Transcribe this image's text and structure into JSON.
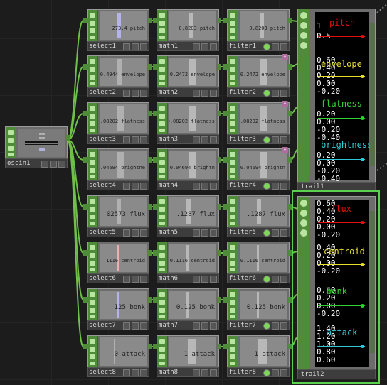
{
  "colors": {
    "wire": "#6fbf4a",
    "pitch": "#e01010",
    "envelope": "#e8e030",
    "flatness": "#30d030",
    "brightness": "#30c8d8",
    "flux": "#e01010",
    "centroid": "#e8e030",
    "bonk": "#30d030",
    "attack": "#30c8d8"
  },
  "oscin": {
    "name": "oscin1"
  },
  "rows": [
    {
      "select": {
        "name": "select1",
        "value": "273.4 pitch"
      },
      "math": {
        "name": "math1",
        "value": "0.8203 pitch"
      },
      "filter": {
        "name": "filter1",
        "value": "0.8203 pitch"
      }
    },
    {
      "select": {
        "name": "select2",
        "value": "0.4944 envelope"
      },
      "math": {
        "name": "math2",
        "value": "0.2472 envelope"
      },
      "filter": {
        "name": "filter2",
        "value": "0.2472 envelope"
      }
    },
    {
      "select": {
        "name": "select3",
        "value": "0.08202 flatness"
      },
      "math": {
        "name": "math3",
        "value": "0.08202 flatness"
      },
      "filter": {
        "name": "filter3",
        "value": "0.08202 flatness"
      }
    },
    {
      "select": {
        "name": "select4",
        "value": "0.04694 brightne"
      },
      "math": {
        "name": "math4",
        "value": "0.04694 brightn"
      },
      "filter": {
        "name": "filter4",
        "value": "0.04694 brightn"
      }
    },
    {
      "select": {
        "name": "select5",
        "value": "02573 flux"
      },
      "math": {
        "name": "math5",
        "value": ".1287 flux"
      },
      "filter": {
        "name": "filter5",
        "value": ".1287 flux"
      }
    },
    {
      "select": {
        "name": "select6",
        "value": "1116 centroid"
      },
      "math": {
        "name": "math6",
        "value": "0.1116 centroid"
      },
      "filter": {
        "name": "filter6",
        "value": "0.1116 centroid"
      }
    },
    {
      "select": {
        "name": "select7",
        "value": "125 bonk"
      },
      "math": {
        "name": "math7",
        "value": "0.125 bonk"
      },
      "filter": {
        "name": "filter7",
        "value": "0.125 bonk"
      }
    },
    {
      "select": {
        "name": "select8",
        "value": "0 attack"
      },
      "math": {
        "name": "math8",
        "value": "1 attack"
      },
      "filter": {
        "name": "filter8",
        "value": "1 attack"
      }
    }
  ],
  "trail1": {
    "name": "trail1",
    "channels": [
      {
        "name": "pitch",
        "ticks": [
          "1",
          "0.5"
        ]
      },
      {
        "name": "envelope",
        "ticks": [
          "0.60",
          "0.40",
          "0.20",
          "0.00",
          "-0.20"
        ]
      },
      {
        "name": "flatness",
        "ticks": [
          "0.20",
          "0.00",
          "-0.20",
          "-0.40"
        ]
      },
      {
        "name": "brightness",
        "ticks": [
          "0.20",
          "0.00",
          "-0.20",
          "-0.40"
        ]
      }
    ]
  },
  "trail2": {
    "name": "trail2",
    "channels": [
      {
        "name": "flux",
        "ticks": [
          "0.60",
          "0.40",
          "0.20",
          "0.00",
          "-0.20"
        ]
      },
      {
        "name": "centroid",
        "ticks": [
          "0.40",
          "0.20",
          "0.00",
          "-0.20"
        ]
      },
      {
        "name": "bonk",
        "ticks": [
          "0.40",
          "0.20",
          "0.00",
          "-0.20"
        ]
      },
      {
        "name": "attack",
        "ticks": [
          "1.40",
          "1.20",
          "1.00",
          "0.80",
          "0.60"
        ]
      }
    ]
  }
}
